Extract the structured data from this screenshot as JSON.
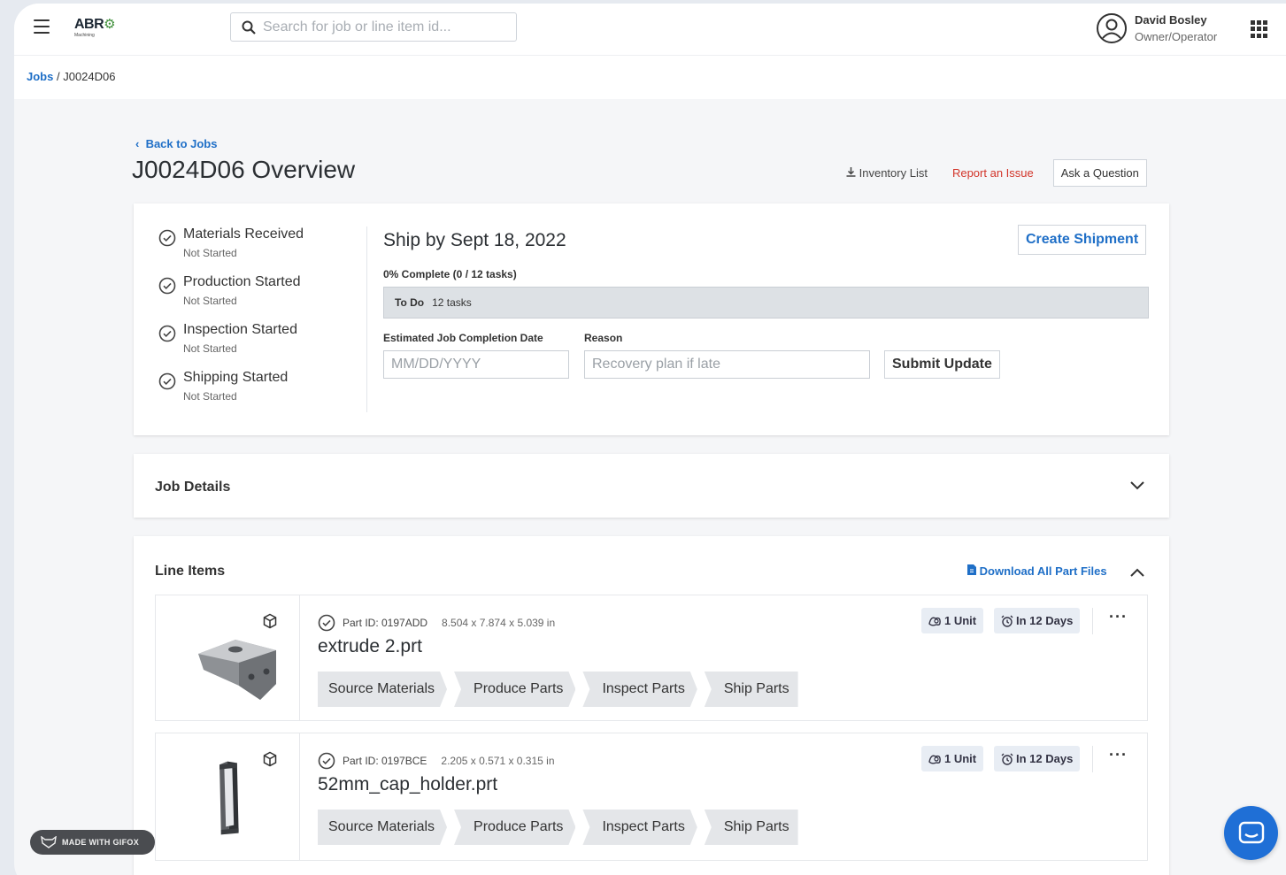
{
  "topbar": {
    "logo_text": "ABR",
    "logo_sub": "Machining",
    "search_placeholder": "Search for job or line item id...",
    "user_name": "David Bosley",
    "user_role": "Owner/Operator"
  },
  "breadcrumb": {
    "root": "Jobs",
    "separator": "/",
    "current": "J0024D06"
  },
  "header": {
    "back_label": "Back to Jobs",
    "title": "J0024D06 Overview",
    "inventory_label": "Inventory List",
    "report_label": "Report an Issue",
    "ask_label": "Ask a Question"
  },
  "status": {
    "milestones": [
      {
        "label": "Materials Received",
        "state": "Not Started"
      },
      {
        "label": "Production Started",
        "state": "Not Started"
      },
      {
        "label": "Inspection Started",
        "state": "Not Started"
      },
      {
        "label": "Shipping Started",
        "state": "Not Started"
      }
    ],
    "ship_by": "Ship by Sept 18, 2022",
    "create_shipment_label": "Create Shipment",
    "completion_text": "0% Complete (0 / 12 tasks)",
    "completion_fraction": 0,
    "todo_label": "To Do",
    "todo_count": "12 tasks",
    "date_label": "Estimated Job Completion Date",
    "date_placeholder": "MM/DD/YYYY",
    "reason_label": "Reason",
    "reason_placeholder": "Recovery plan if late",
    "submit_label": "Submit Update"
  },
  "job_details": {
    "title": "Job Details"
  },
  "line_items": {
    "title": "Line Items",
    "download_label": "Download All Part Files",
    "items": [
      {
        "part_id": "Part ID: 0197ADD",
        "dims": "8.504 x 7.874 x 5.039 in",
        "filename": "extrude 2.prt",
        "units": "1 Unit",
        "due": "In 12 Days",
        "steps": [
          "Source Materials",
          "Produce Parts",
          "Inspect Parts",
          "Ship Parts"
        ]
      },
      {
        "part_id": "Part ID: 0197BCE",
        "dims": "2.205 x 0.571 x 0.315 in",
        "filename": "52mm_cap_holder.prt",
        "units": "1 Unit",
        "due": "In 12 Days",
        "steps": [
          "Source Materials",
          "Produce Parts",
          "Inspect Parts",
          "Ship Parts"
        ]
      }
    ]
  },
  "watermark": "MADE WITH GIFOX",
  "colors": {
    "accent": "#1f6fc7",
    "danger": "#d2352a",
    "chat": "#1f6fd6"
  }
}
